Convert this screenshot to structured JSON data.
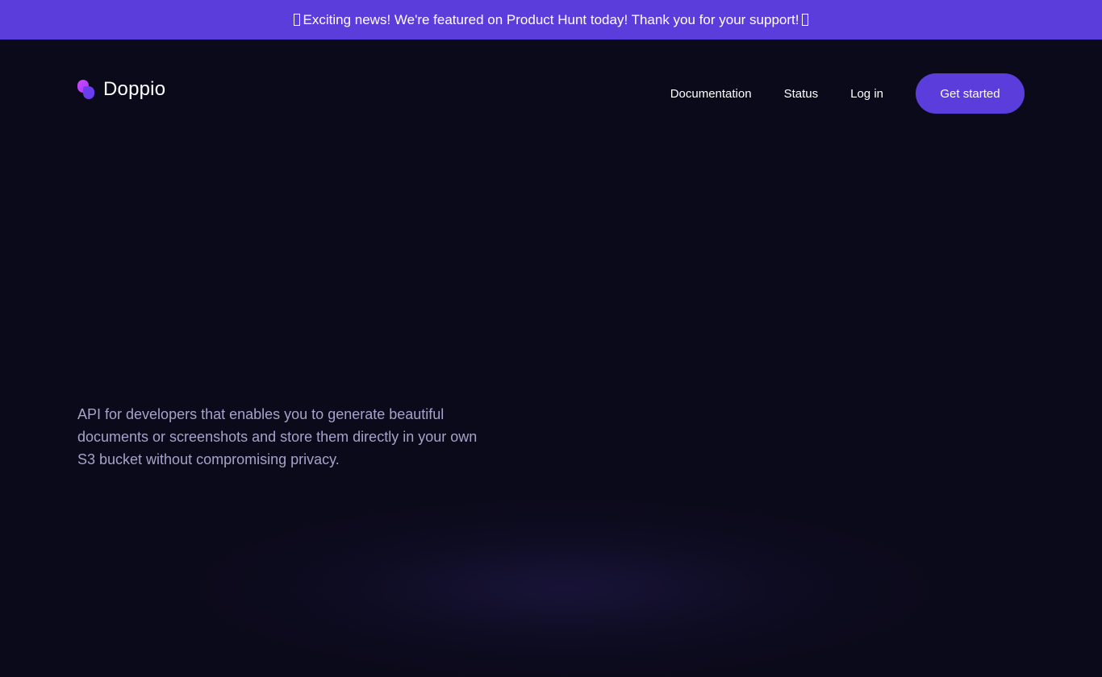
{
  "announcement": {
    "text": "Exciting news! We're featured on Product Hunt today! Thank you for your support!"
  },
  "header": {
    "logo_text": "Doppio",
    "nav": {
      "documentation": "Documentation",
      "status": "Status",
      "login": "Log in"
    },
    "cta_label": "Get started"
  },
  "hero": {
    "description": "API for developers that enables you to generate beautiful documents or screenshots and store them directly in your own S3 bucket without compromising privacy."
  },
  "colors": {
    "accent": "#5b3ddc",
    "background": "#0b0a1a",
    "muted_text": "#a7a2c9"
  }
}
